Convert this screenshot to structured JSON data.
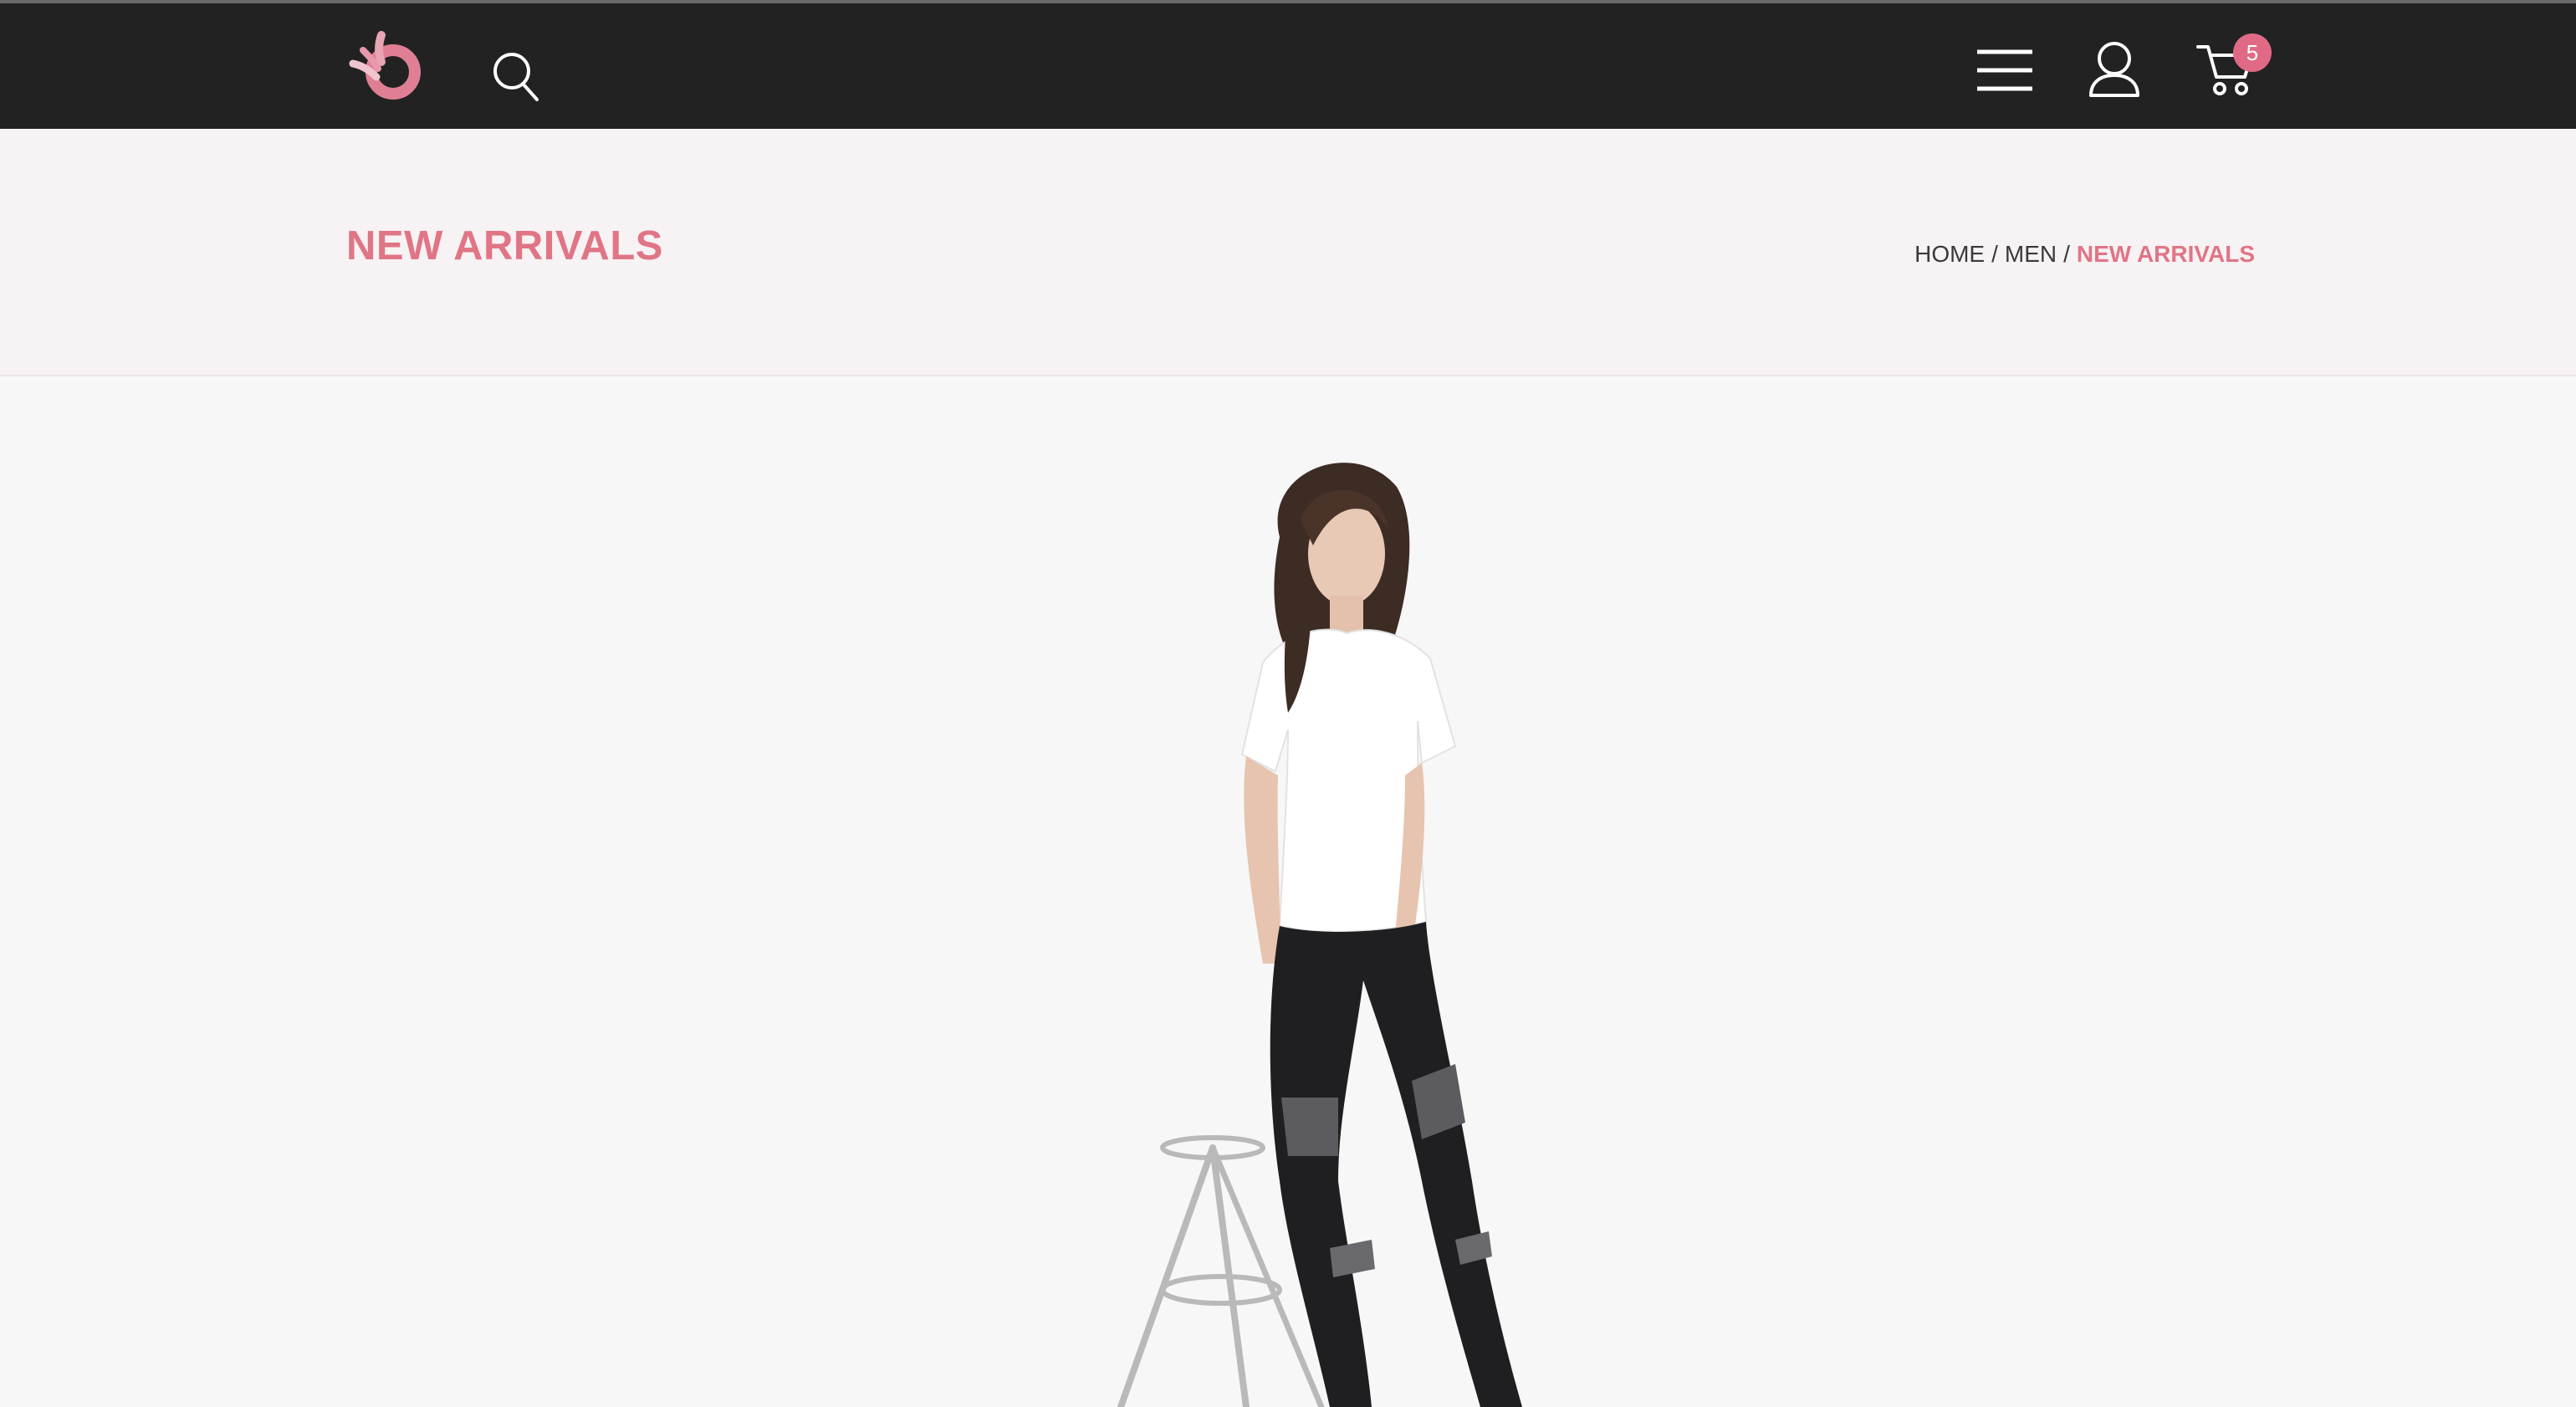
{
  "header": {
    "cart_count": "5"
  },
  "hero": {
    "title": "NEW ARRIVALS",
    "breadcrumb": {
      "home": "HOME",
      "separator": "/",
      "men": "MEN",
      "current": "NEW ARRIVALS"
    }
  },
  "colors": {
    "accent": "#e07586",
    "header_bg": "#222222",
    "hero_bg": "#f7f2f3",
    "page_bg": "#f7f7f7"
  },
  "icons": {
    "logo": "brand-logo",
    "search": "search-icon",
    "menu": "hamburger-menu-icon",
    "user": "user-icon",
    "cart": "cart-icon"
  }
}
